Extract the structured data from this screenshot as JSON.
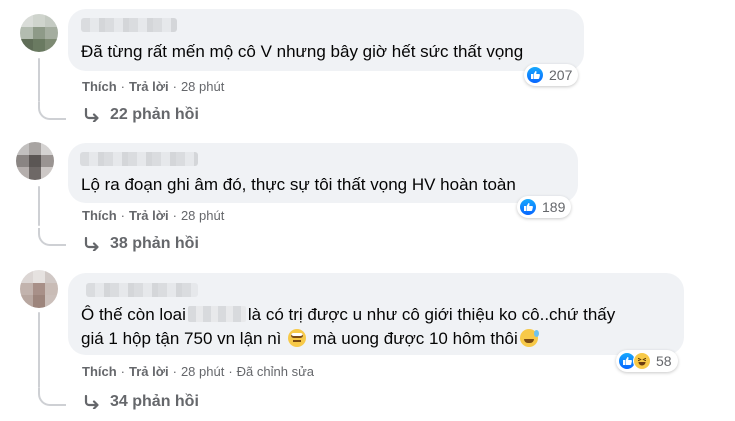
{
  "colors": {
    "bubble": "#f0f2f5",
    "meta": "#65676b",
    "like_blue": "#0866ff",
    "haha_yellow": "#f7c948"
  },
  "comments": [
    {
      "text": "Đã từng rất mến mộ cô V nhưng bây giờ hết sức thất vọng",
      "actions": {
        "like": "Thích",
        "reply": "Trả lời",
        "time": "28 phút"
      },
      "reactions": {
        "icons": [
          "like-icon"
        ],
        "count": "207"
      },
      "replies_label": "22 phản hồi"
    },
    {
      "text": "Lộ ra đoạn ghi âm đó, thực sự tôi thất vọng HV hoàn toàn",
      "actions": {
        "like": "Thích",
        "reply": "Trả lời",
        "time": "28 phút"
      },
      "reactions": {
        "icons": [
          "like-icon"
        ],
        "count": "189"
      },
      "replies_label": "38 phản hồi"
    },
    {
      "text_line1_a": "Ô thế còn loai",
      "text_line1_b": "là có trị được u như cô giới thiệu ko cô..chứ thấy",
      "text_line2_a": "giá 1 hộp tận 750 vn lận nì",
      "text_line2_b": "mà uong được 10 hôm thôi",
      "actions": {
        "like": "Thích",
        "reply": "Trả lời",
        "time": "28 phút",
        "edited": "Đã chỉnh sửa"
      },
      "reactions": {
        "icons": [
          "like-icon",
          "haha-icon"
        ],
        "count": "58"
      },
      "replies_label": "34 phản hồi"
    }
  ]
}
